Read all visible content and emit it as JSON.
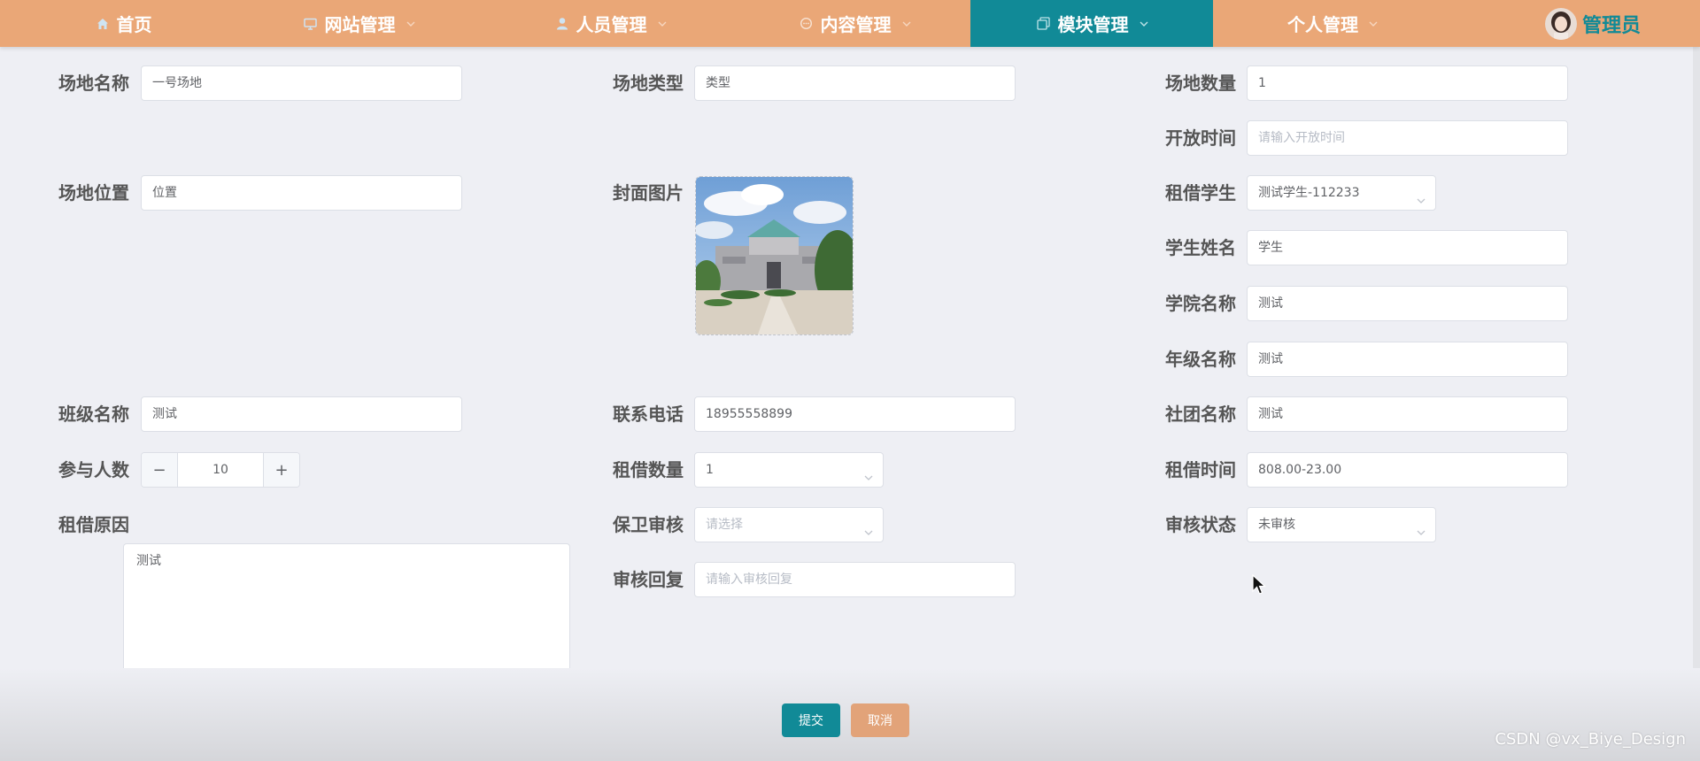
{
  "nav": {
    "items": [
      {
        "label": "首页",
        "icon": "home-icon"
      },
      {
        "label": "网站管理",
        "icon": "monitor-icon"
      },
      {
        "label": "人员管理",
        "icon": "user-icon"
      },
      {
        "label": "内容管理",
        "icon": "chat-icon"
      },
      {
        "label": "模块管理",
        "icon": "copy-icon"
      },
      {
        "label": "个人管理",
        "icon": ""
      }
    ],
    "active_index": 4,
    "user_name": "管理员"
  },
  "form": {
    "venue_name": {
      "label": "场地名称",
      "value": "一号场地"
    },
    "venue_type": {
      "label": "场地类型",
      "value": "类型"
    },
    "venue_count": {
      "label": "场地数量",
      "value": "1"
    },
    "open_time": {
      "label": "开放时间",
      "placeholder": "请输入开放时间"
    },
    "venue_location": {
      "label": "场地位置",
      "value": "位置"
    },
    "cover_image": {
      "label": "封面图片"
    },
    "renter_student": {
      "label": "租借学生",
      "value": "测试学生-112233"
    },
    "student_name": {
      "label": "学生姓名",
      "value": "学生"
    },
    "college_name": {
      "label": "学院名称",
      "value": "测试"
    },
    "grade_name": {
      "label": "年级名称",
      "value": "测试"
    },
    "class_name": {
      "label": "班级名称",
      "value": "测试"
    },
    "phone": {
      "label": "联系电话",
      "value": "18955558899"
    },
    "club_name": {
      "label": "社团名称",
      "value": "测试"
    },
    "participants": {
      "label": "参与人数",
      "value": "10",
      "dec": "−",
      "inc": "+"
    },
    "rent_qty": {
      "label": "租借数量",
      "value": "1"
    },
    "rent_time": {
      "label": "租借时间",
      "value": "808.00-23.00"
    },
    "rent_reason": {
      "label": "租借原因",
      "value": "测试"
    },
    "security_review": {
      "label": "保卫审核",
      "placeholder": "请选择"
    },
    "review_status": {
      "label": "审核状态",
      "value": "未审核"
    },
    "review_reply": {
      "label": "审核回复",
      "placeholder": "请输入审核回复"
    }
  },
  "actions": {
    "submit": "提交",
    "cancel": "取消"
  },
  "colors": {
    "nav_bg": "#eaa777",
    "accent": "#118a97",
    "cancel": "#e2a379"
  },
  "watermark": "CSDN @vx_Biye_Design"
}
